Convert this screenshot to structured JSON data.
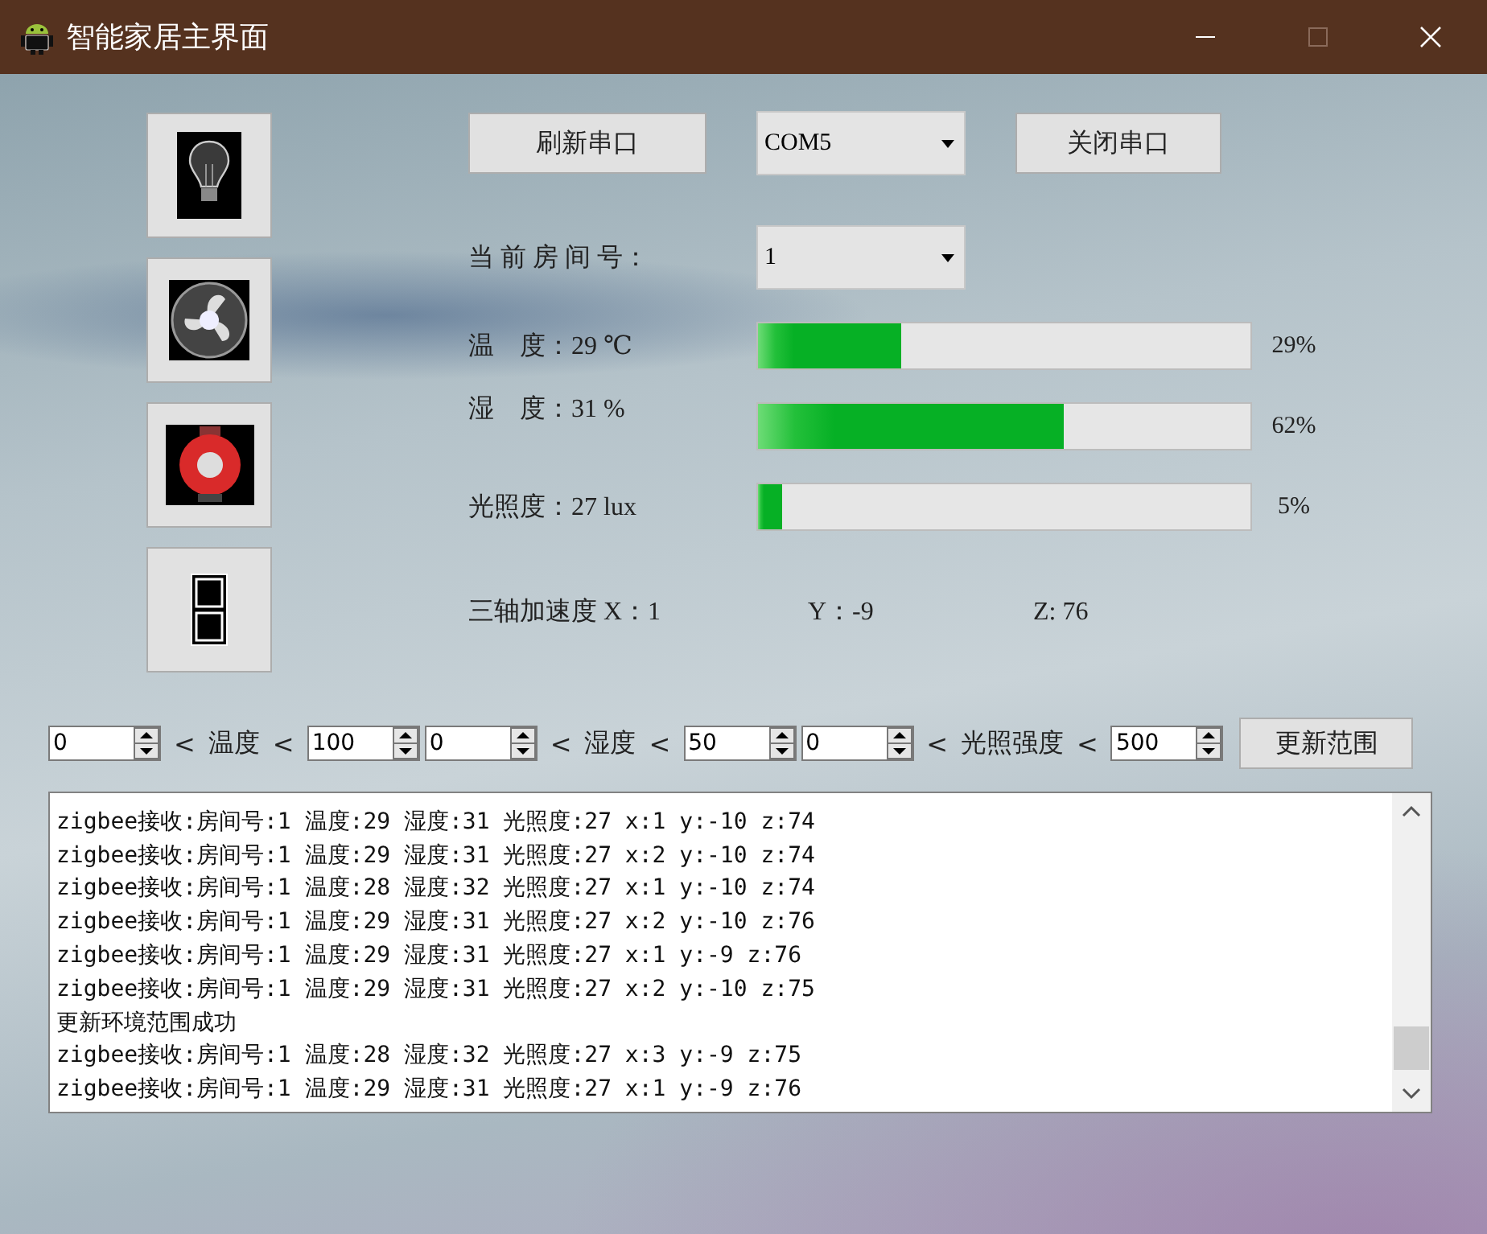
{
  "window": {
    "title": "智能家居主界面"
  },
  "serial": {
    "refresh_button": "刷新串口",
    "port": "COM5",
    "close_button": "关闭串口"
  },
  "room": {
    "label": "当 前 房 间 号：",
    "value": "1"
  },
  "sensors": [
    {
      "label": "温　度：29 ℃",
      "level": 0.29,
      "reading": "29%"
    },
    {
      "label": "湿　度：31 %",
      "level": 0.62,
      "reading": "62%"
    },
    {
      "label": "光照度：27 lux",
      "level": 0.05,
      "reading": "5%"
    }
  ],
  "acceleration": {
    "x": "三轴加速度 X：1",
    "y": "Y：-9",
    "z": "Z: 76"
  },
  "ranges": [
    {
      "min": "0",
      "lt_1": "<",
      "label": "温度",
      "lt_2": "<",
      "max": "100"
    },
    {
      "min": "0",
      "lt_1": "<",
      "label": "湿度",
      "lt_2": "<",
      "max": "50"
    },
    {
      "min": "0",
      "lt_1": "<",
      "label": "光照强度",
      "lt_2": "<",
      "max": "500"
    }
  ],
  "update_button": "更新范围",
  "log": {
    "lines": [
      "zigbee接收:房间号:1 温度:29 湿度:31 光照度:27 x:1 y:-10 z:74",
      "zigbee接收:房间号:1 温度:29 湿度:31 光照度:27 x:2 y:-10 z:74",
      "zigbee接收:房间号:1 温度:28 湿度:32 光照度:27 x:1 y:-10 z:74",
      "zigbee接收:房间号:1 温度:29 湿度:31 光照度:27 x:2 y:-10 z:76",
      "zigbee接收:房间号:1 温度:29 湿度:31 光照度:27 x:1 y:-9 z:76",
      "zigbee接收:房间号:1 温度:29 湿度:31 光照度:27 x:2 y:-10 z:75",
      "更新环境范围成功",
      "zigbee接收:房间号:1 温度:28 湿度:32 光照度:27 x:3 y:-9 z:75",
      "zigbee接收:房间号:1 温度:29 湿度:31 光照度:27 x:1 y:-9 z:76"
    ]
  }
}
